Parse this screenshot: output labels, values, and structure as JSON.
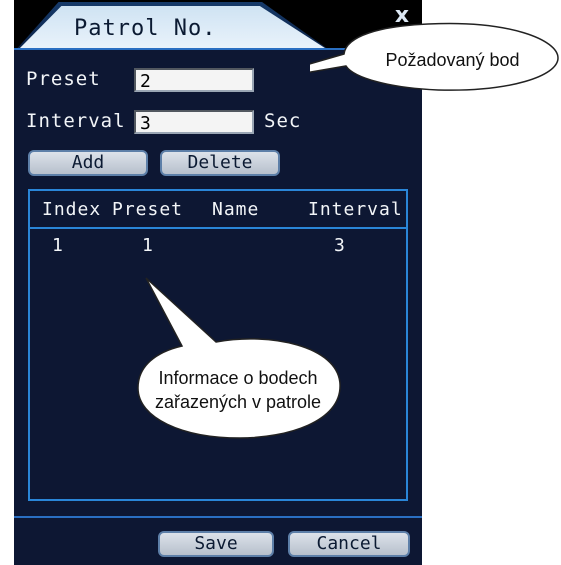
{
  "dialog": {
    "title": "Patrol No.",
    "close_label": "x",
    "preset_label": "Preset",
    "preset_value": "2",
    "interval_label": "Interval",
    "interval_value": "3",
    "interval_unit": "Sec",
    "add_label": "Add",
    "delete_label": "Delete",
    "save_label": "Save",
    "cancel_label": "Cancel"
  },
  "table": {
    "headers": [
      "Index",
      "Preset",
      "Name",
      "Interval"
    ],
    "rows": [
      {
        "index": "1",
        "preset": "1",
        "name": "",
        "interval": "3"
      }
    ]
  },
  "callouts": {
    "preset_note": "Požadovaný bod",
    "table_note_line1": "Informace o bodech",
    "table_note_line2": "zařazených v patrole"
  }
}
